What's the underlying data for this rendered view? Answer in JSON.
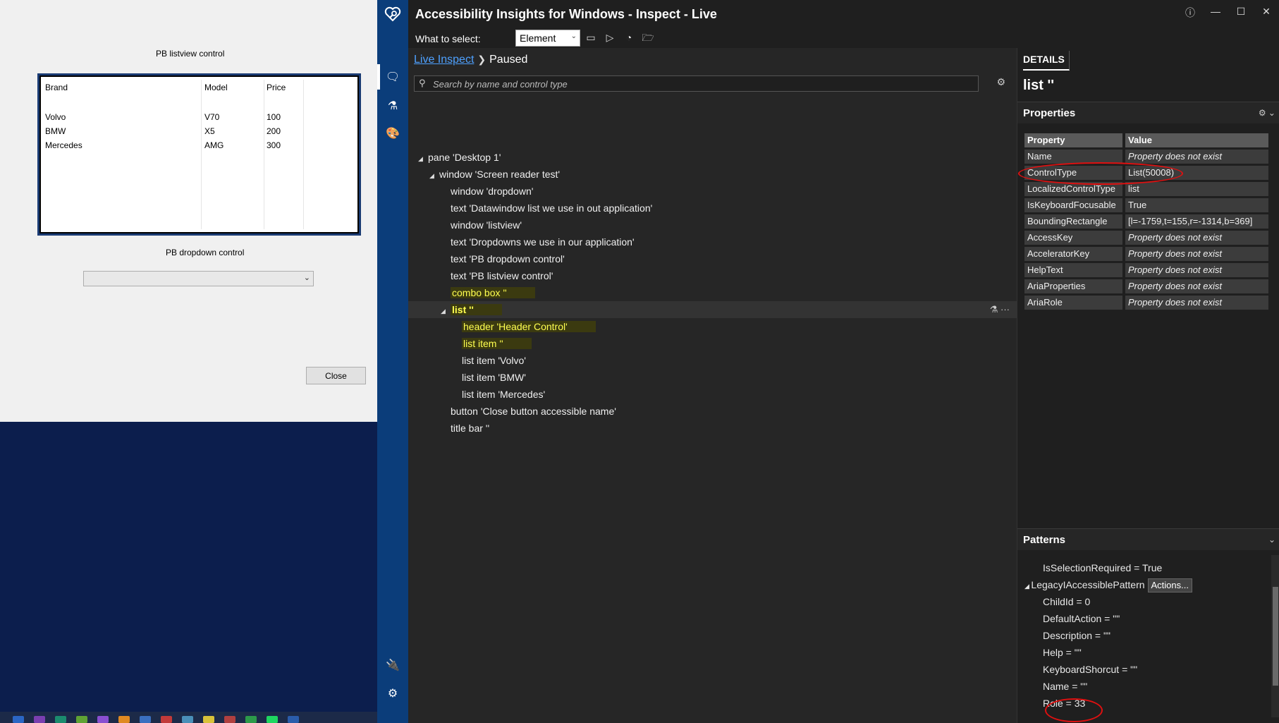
{
  "test_app": {
    "listview_label": "PB listview control",
    "listview_headers": [
      "Brand",
      "Model",
      "Price"
    ],
    "listview_rows": [
      [
        "Volvo",
        "V70",
        "100"
      ],
      [
        "BMW",
        "X5",
        "200"
      ],
      [
        "Mercedes",
        "AMG",
        "300"
      ]
    ],
    "dropdown_label": "PB dropdown control",
    "dropdown_value": "",
    "close_button": "Close"
  },
  "ai": {
    "window_title": "Accessibility Insights for Windows - Inspect - Live",
    "what_to_select_label": "What to select:",
    "what_to_select_value": "Element",
    "breadcrumb_link": "Live Inspect",
    "breadcrumb_current": "Paused",
    "search_placeholder": "Search by name and control type",
    "tree": [
      {
        "label": "pane 'Desktop 1'",
        "indent": 0,
        "tri": "◢",
        "highlight": false,
        "selected": false
      },
      {
        "label": "window 'Screen reader test'",
        "indent": 1,
        "tri": "◢",
        "highlight": false,
        "selected": false
      },
      {
        "label": "window 'dropdown'",
        "indent": 2,
        "tri": "",
        "highlight": false,
        "selected": false
      },
      {
        "label": "text 'Datawindow list we use in out application'",
        "indent": 2,
        "tri": "",
        "highlight": false,
        "selected": false
      },
      {
        "label": "window 'listview'",
        "indent": 2,
        "tri": "",
        "highlight": false,
        "selected": false
      },
      {
        "label": "text 'Dropdowns we use in our application'",
        "indent": 2,
        "tri": "",
        "highlight": false,
        "selected": false
      },
      {
        "label": "text 'PB dropdown control'",
        "indent": 2,
        "tri": "",
        "highlight": false,
        "selected": false
      },
      {
        "label": "text 'PB listview control'",
        "indent": 2,
        "tri": "",
        "highlight": false,
        "selected": false
      },
      {
        "label": "combo box ''",
        "indent": 2,
        "tri": "",
        "highlight": true,
        "selected": false
      },
      {
        "label": "list ''",
        "indent": 2,
        "tri": "◢",
        "highlight": true,
        "selected": true
      },
      {
        "label": "header 'Header Control'",
        "indent": 3,
        "tri": "",
        "highlight": true,
        "selected": false
      },
      {
        "label": "list item ''",
        "indent": 3,
        "tri": "",
        "highlight": true,
        "selected": false
      },
      {
        "label": "list item 'Volvo'",
        "indent": 3,
        "tri": "",
        "highlight": false,
        "selected": false
      },
      {
        "label": "list item 'BMW'",
        "indent": 3,
        "tri": "",
        "highlight": false,
        "selected": false
      },
      {
        "label": "list item 'Mercedes'",
        "indent": 3,
        "tri": "",
        "highlight": false,
        "selected": false
      },
      {
        "label": "button 'Close button accessible name'",
        "indent": 2,
        "tri": "",
        "highlight": false,
        "selected": false
      },
      {
        "label": "title bar ''",
        "indent": 2,
        "tri": "",
        "highlight": false,
        "selected": false
      }
    ],
    "details_tab": "DETAILS",
    "details_header": "list ''",
    "properties_title": "Properties",
    "prop_col_property": "Property",
    "prop_col_value": "Value",
    "properties": [
      {
        "k": "Name",
        "v": "Property does not exist",
        "missing": true
      },
      {
        "k": "ControlType",
        "v": "List(50008)",
        "missing": false
      },
      {
        "k": "LocalizedControlType",
        "v": "list",
        "missing": false
      },
      {
        "k": "IsKeyboardFocusable",
        "v": "True",
        "missing": false
      },
      {
        "k": "BoundingRectangle",
        "v": "[l=-1759,t=155,r=-1314,b=369]",
        "missing": false
      },
      {
        "k": "AccessKey",
        "v": "Property does not exist",
        "missing": true
      },
      {
        "k": "AcceleratorKey",
        "v": "Property does not exist",
        "missing": true
      },
      {
        "k": "HelpText",
        "v": "Property does not exist",
        "missing": true
      },
      {
        "k": "AriaProperties",
        "v": "Property does not exist",
        "missing": true
      },
      {
        "k": "AriaRole",
        "v": "Property does not exist",
        "missing": true
      }
    ],
    "patterns_title": "Patterns",
    "patterns": [
      {
        "text": "IsSelectionRequired = True",
        "indent": 2
      },
      {
        "text": "LegacyIAccessiblePattern",
        "indent": 0,
        "tri": "◢",
        "button": "Actions..."
      },
      {
        "text": "ChildId = 0",
        "indent": 2
      },
      {
        "text": "DefaultAction = \"\"",
        "indent": 2
      },
      {
        "text": "Description = \"\"",
        "indent": 2
      },
      {
        "text": "Help = \"\"",
        "indent": 2
      },
      {
        "text": "KeyboardShorcut = \"\"",
        "indent": 2
      },
      {
        "text": "Name = \"\"",
        "indent": 2
      },
      {
        "text": "Role = 33",
        "indent": 2
      }
    ],
    "colors": {
      "rail": "#0b3d7a",
      "highlight_text": "#ffff50",
      "annotation": "#e01010",
      "link": "#4ea1ff"
    }
  }
}
